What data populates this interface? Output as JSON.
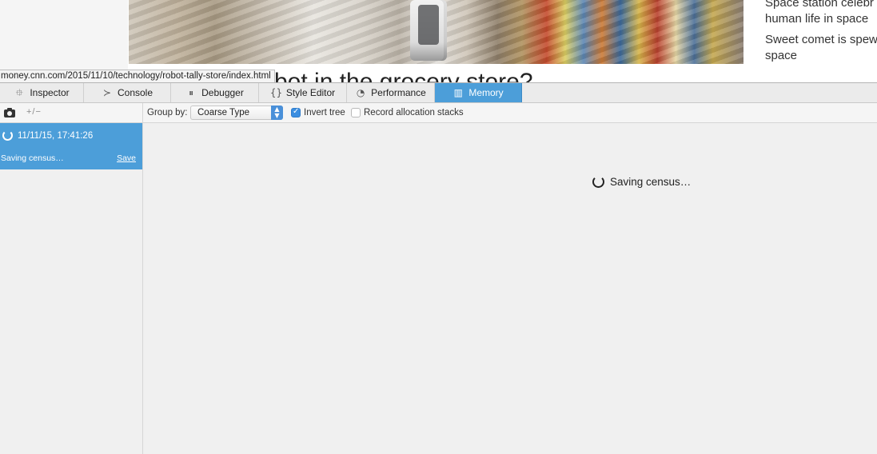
{
  "page": {
    "headline": "bot in the grocery store?",
    "sidebar_stories": [
      {
        "line1": "Space station celebr",
        "line2": "human life in space"
      },
      {
        "line1": "Sweet comet is spew",
        "line2": "space"
      }
    ]
  },
  "status_url": "money.cnn.com/2015/11/10/technology/robot-tally-store/index.html",
  "devtools": {
    "tabs": [
      {
        "label": "Inspector",
        "icon": "inspector-icon",
        "selected": false
      },
      {
        "label": "Console",
        "icon": "console-icon",
        "selected": false
      },
      {
        "label": "Debugger",
        "icon": "debugger-icon",
        "selected": false
      },
      {
        "label": "Style Editor",
        "icon": "style-editor-icon",
        "selected": false
      },
      {
        "label": "Performance",
        "icon": "performance-icon",
        "selected": false
      },
      {
        "label": "Memory",
        "icon": "memory-icon",
        "selected": true
      }
    ],
    "toolbar": {
      "diff_label": "+/−",
      "group_by_label": "Group by:",
      "group_by_value": "Coarse Type",
      "invert_tree_label": "Invert tree",
      "invert_tree_checked": true,
      "record_stacks_label": "Record allocation stacks",
      "record_stacks_checked": false
    },
    "snapshot": {
      "time": "11/11/15, 17:41:26",
      "status": "Saving census…",
      "save_label": "Save"
    },
    "main": {
      "status": "Saving census…"
    },
    "colors": {
      "accent": "#4c9ed9",
      "checkbox": "#3b8ee0"
    }
  }
}
